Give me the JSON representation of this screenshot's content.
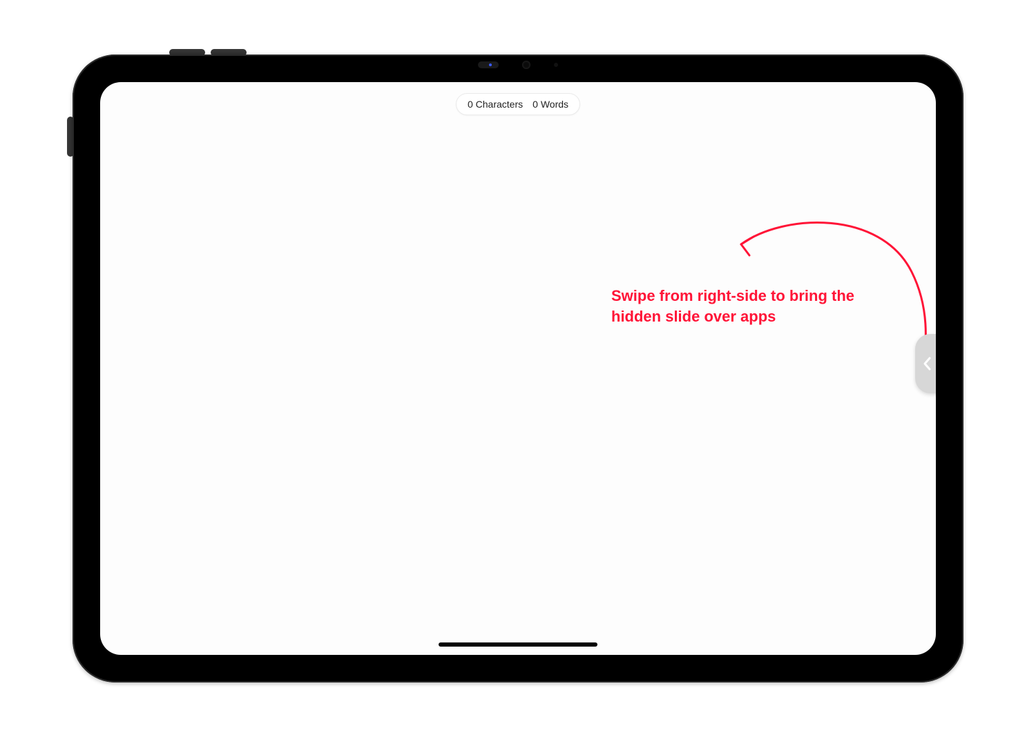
{
  "stats": {
    "characters_label": "0 Characters",
    "words_label": "0 Words"
  },
  "annotation": {
    "text": "Swipe from right-side to bring the hidden slide over apps",
    "color": "#ff1437"
  }
}
